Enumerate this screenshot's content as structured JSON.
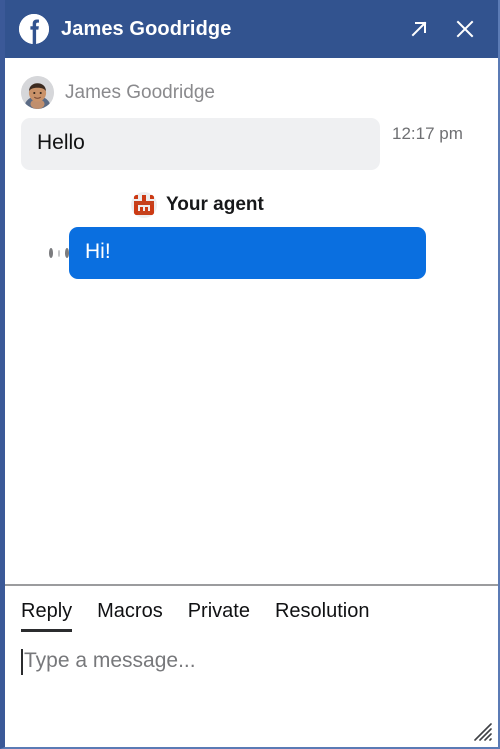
{
  "window": {
    "accent_color": "#32538f",
    "border_color": "#3b5998"
  },
  "header": {
    "logo_icon": "facebook-icon",
    "title": "James Goodridge",
    "expand_icon": "arrow-up-right-icon",
    "close_icon": "close-icon"
  },
  "conversation": {
    "messages": [
      {
        "direction": "incoming",
        "avatar_icon": "user-avatar",
        "sender": "James Goodridge",
        "text": "Hello",
        "time": "12:17 pm"
      },
      {
        "direction": "outgoing",
        "avatar_icon": "agent-robot-icon",
        "sender": "Your agent",
        "text": "Hi!",
        "status_indicator": "sending-dots",
        "bubble_color": "#0a6fe0"
      }
    ]
  },
  "composer": {
    "tabs": [
      {
        "label": "Reply",
        "active": true
      },
      {
        "label": "Macros",
        "active": false
      },
      {
        "label": "Private",
        "active": false
      },
      {
        "label": "Resolution",
        "active": false
      }
    ],
    "input": {
      "value": "",
      "placeholder": "Type a message..."
    },
    "resize_icon": "resize-grip-icon"
  }
}
